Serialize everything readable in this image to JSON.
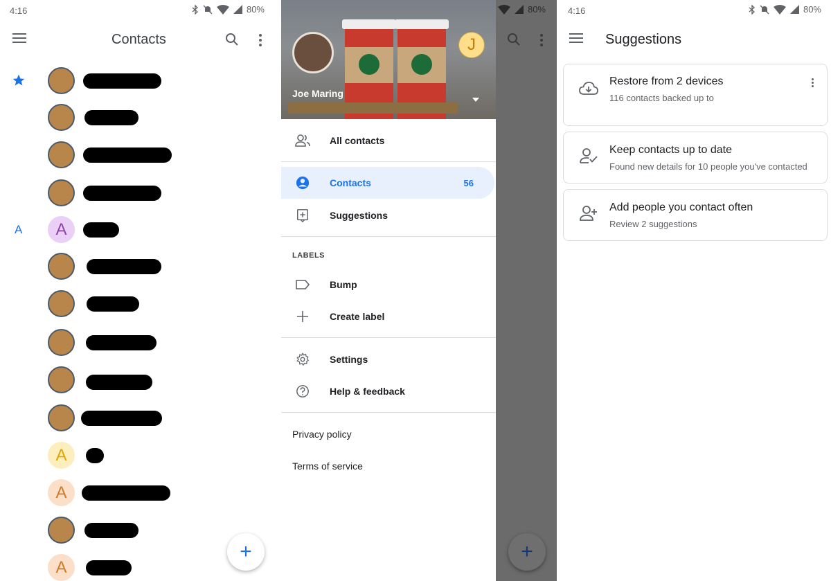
{
  "status": {
    "time": "4:16",
    "battery": "80%"
  },
  "contacts_screen": {
    "title": "Contacts",
    "section_letter": "A",
    "letter_avatars": [
      "A",
      "A",
      "A",
      "A"
    ],
    "fab_label": "+"
  },
  "drawer": {
    "account_name": "Joe Maring",
    "account_initial": "J",
    "items_top": [
      {
        "label": "All contacts",
        "icon": "people-icon"
      }
    ],
    "items_main": [
      {
        "label": "Contacts",
        "icon": "account-circle-icon",
        "count": "56",
        "active": true
      },
      {
        "label": "Suggestions",
        "icon": "suggestion-icon"
      }
    ],
    "labels_heading": "LABELS",
    "labels": [
      {
        "label": "Bump",
        "icon": "label-icon"
      },
      {
        "label": "Create label",
        "icon": "plus-icon"
      }
    ],
    "settings": [
      {
        "label": "Settings",
        "icon": "gear-icon"
      },
      {
        "label": "Help & feedback",
        "icon": "help-icon"
      }
    ],
    "footer_links": [
      "Privacy policy",
      "Terms of service"
    ],
    "fab_label": "+"
  },
  "suggestions_screen": {
    "title": "Suggestions",
    "cards": [
      {
        "title": "Restore from 2 devices",
        "subtitle": "116 contacts backed up to",
        "icon": "cloud-download-icon"
      },
      {
        "title": "Keep contacts up to date",
        "subtitle": "Found new details for 10 people you've contacted",
        "icon": "person-check-icon"
      },
      {
        "title": "Add people you contact often",
        "subtitle": "Review 2 suggestions",
        "icon": "person-add-icon"
      }
    ]
  }
}
